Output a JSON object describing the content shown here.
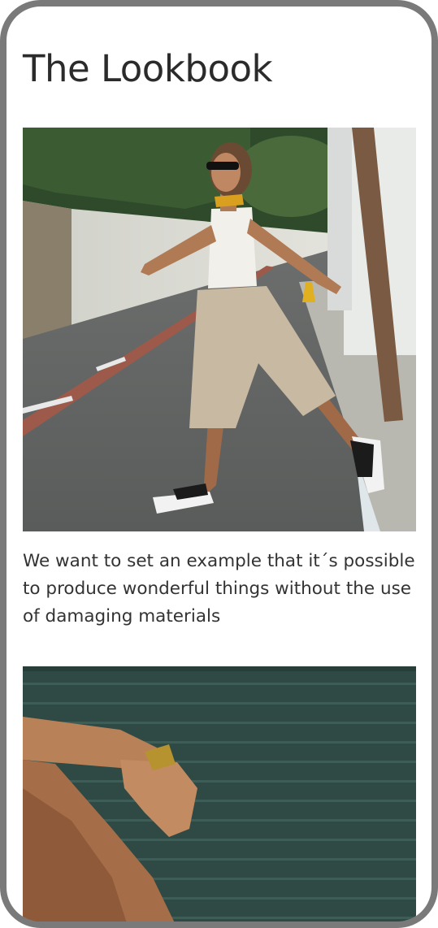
{
  "page": {
    "title": "The Lookbook"
  },
  "lookbook": {
    "items": [
      {
        "image": "model-jumping-on-street-photo"
      },
      {
        "caption": "We want to set an example that it´s possible to produce wonderful things without the use of damaging materials"
      },
      {
        "image": "arm-bracelet-against-green-shutter-photo"
      }
    ]
  },
  "colors": {
    "frame": "#7a7a7a",
    "text": "#2b2b2b",
    "caption_text": "#333333",
    "background": "#ffffff"
  }
}
